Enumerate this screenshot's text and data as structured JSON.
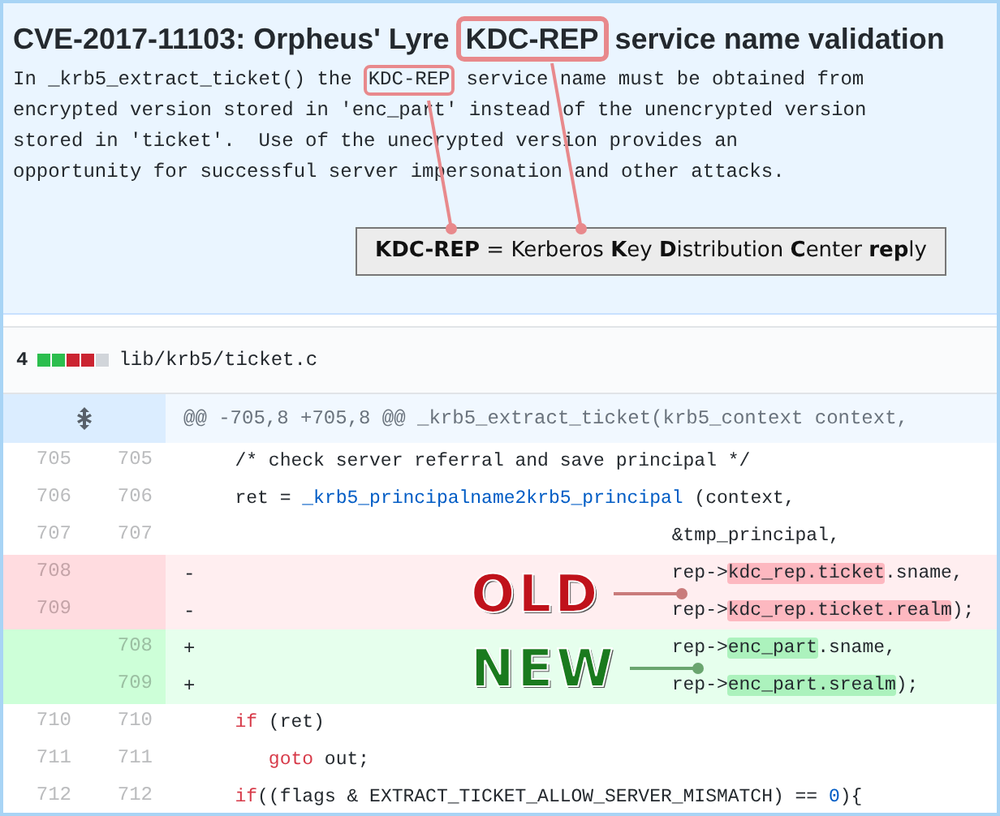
{
  "header": {
    "title_before": "CVE-2017-11103: Orpheus' Lyre",
    "title_callout": "KDC-REP",
    "title_after": "service name validation",
    "description_line_1": {
      "before": "In _krb5_extract_ticket() the",
      "callout": "KDC-REP",
      "after": "service name must be obtained from"
    },
    "description_lines": [
      "encrypted version stored in 'enc_part' instead of the unencrypted version",
      "stored in 'ticket'.  Use of the unecrypted version provides an",
      "opportunity for successful server impersonation and other attacks."
    ],
    "definition": "**KDC-REP** = Kerberos **K**ey **D**istribution **C**enter **rep**ly"
  },
  "file": {
    "changes": "4",
    "diffstat": [
      {
        "kind": "add"
      },
      {
        "kind": "add"
      },
      {
        "kind": "del"
      },
      {
        "kind": "del"
      },
      {
        "kind": "neutral"
      }
    ],
    "path": "lib/krb5/ticket.c"
  },
  "hunk": "@@ -705,8 +705,8 @@ _krb5_extract_ticket(krb5_context context,",
  "rows": [
    {
      "kind": "context",
      "old": "705",
      "new": "705",
      "code": [
        {
          "kind": "plain",
          "text": "\t/* check server referral and save principal */"
        }
      ]
    },
    {
      "kind": "context",
      "old": "706",
      "new": "706",
      "code": [
        {
          "kind": "plain",
          "text": "\tret = "
        },
        {
          "kind": "func",
          "text": "_krb5_principalname2krb5_principal"
        },
        {
          "kind": "plain",
          "text": " (context,"
        }
      ]
    },
    {
      "kind": "context",
      "old": "707",
      "new": "707",
      "code": [
        {
          "kind": "plain",
          "text": "\t\t\t\t\t\t\t\t\t\t\t\t\t\t&tmp_principal,"
        }
      ]
    },
    {
      "kind": "del",
      "old": "708",
      "sign": "-",
      "marker": "OLD",
      "code": [
        {
          "kind": "plain",
          "text": "\t\t\t\t\t\t\t\t\t\t\t\t\t\trep->"
        },
        {
          "kind": "mark",
          "text": "kdc_rep.ticket"
        },
        {
          "kind": "plain",
          "text": ".sname,"
        }
      ]
    },
    {
      "kind": "del",
      "old": "709",
      "sign": "-",
      "code": [
        {
          "kind": "plain",
          "text": "\t\t\t\t\t\t\t\t\t\t\t\t\t\trep->"
        },
        {
          "kind": "mark",
          "text": "kdc_rep.ticket.realm"
        },
        {
          "kind": "plain",
          "text": ");"
        }
      ]
    },
    {
      "kind": "add",
      "new": "708",
      "sign": "+",
      "marker": "NEW",
      "code": [
        {
          "kind": "plain",
          "text": "\t\t\t\t\t\t\t\t\t\t\t\t\t\trep->"
        },
        {
          "kind": "mark",
          "text": "enc_part"
        },
        {
          "kind": "plain",
          "text": ".sname,"
        }
      ]
    },
    {
      "kind": "add",
      "new": "709",
      "sign": "+",
      "code": [
        {
          "kind": "plain",
          "text": "\t\t\t\t\t\t\t\t\t\t\t\t\t\trep->"
        },
        {
          "kind": "mark",
          "text": "enc_part.srealm"
        },
        {
          "kind": "plain",
          "text": ");"
        }
      ]
    },
    {
      "kind": "context",
      "old": "710",
      "new": "710",
      "code": [
        {
          "kind": "keyword",
          "text": "\tif"
        },
        {
          "kind": "plain",
          "text": " (ret)"
        }
      ]
    },
    {
      "kind": "context",
      "old": "711",
      "new": "711",
      "code": [
        {
          "kind": "keyword",
          "text": "\t\tgoto"
        },
        {
          "kind": "plain",
          "text": " out;"
        }
      ]
    },
    {
      "kind": "context",
      "old": "712",
      "new": "712",
      "code": [
        {
          "kind": "keyword",
          "text": "\tif"
        },
        {
          "kind": "plain",
          "text": "((flags & EXTRACT_TICKET_ALLOW_SERVER_MISMATCH) == "
        },
        {
          "kind": "number",
          "text": "0"
        },
        {
          "kind": "plain",
          "text": "){"
        }
      ]
    }
  ]
}
